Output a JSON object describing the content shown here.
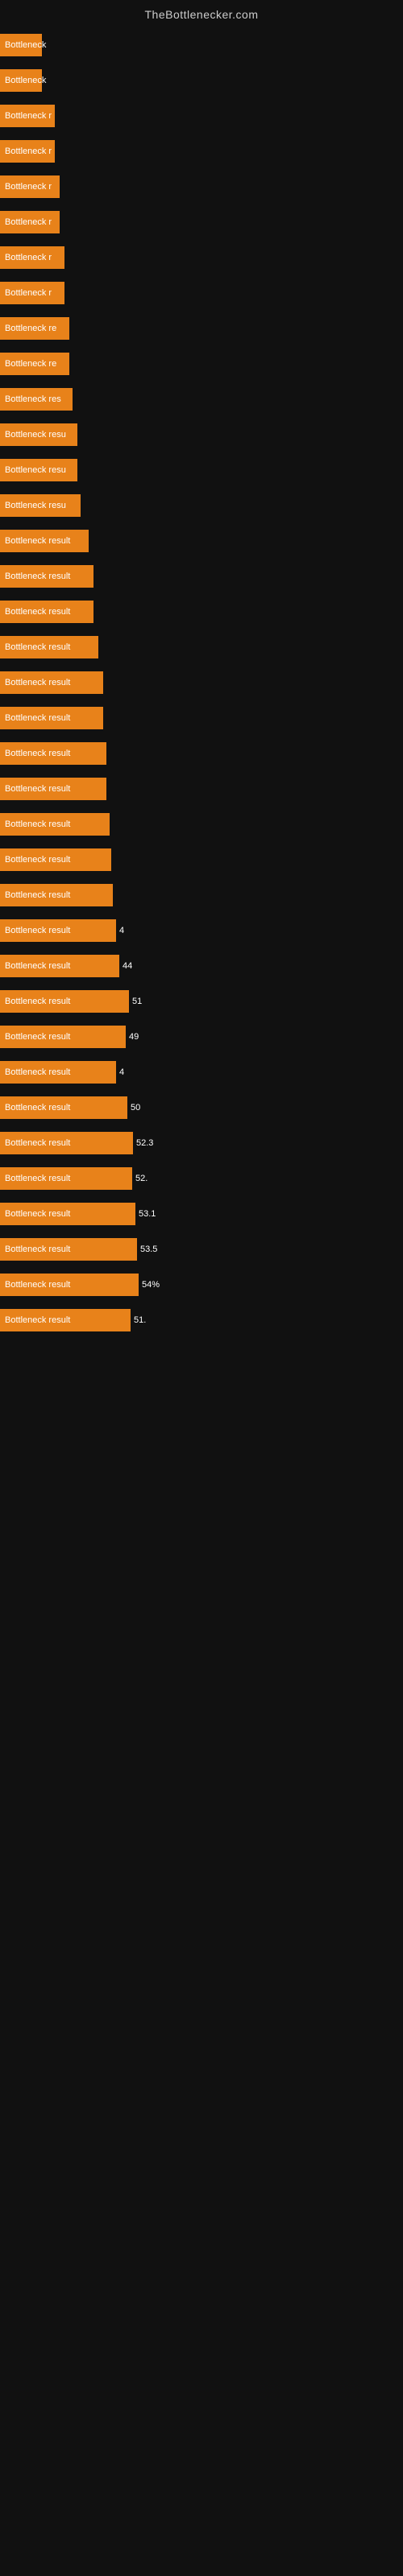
{
  "site_title": "TheBottlenecker.com",
  "bars": [
    {
      "label": "Bottleneck",
      "value": "",
      "width": 52
    },
    {
      "label": "Bottleneck",
      "value": "",
      "width": 52
    },
    {
      "label": "Bottleneck r",
      "value": "",
      "width": 68
    },
    {
      "label": "Bottleneck r",
      "value": "",
      "width": 68
    },
    {
      "label": "Bottleneck r",
      "value": "",
      "width": 74
    },
    {
      "label": "Bottleneck r",
      "value": "",
      "width": 74
    },
    {
      "label": "Bottleneck r",
      "value": "",
      "width": 80
    },
    {
      "label": "Bottleneck r",
      "value": "",
      "width": 80
    },
    {
      "label": "Bottleneck re",
      "value": "",
      "width": 86
    },
    {
      "label": "Bottleneck re",
      "value": "",
      "width": 86
    },
    {
      "label": "Bottleneck res",
      "value": "",
      "width": 90
    },
    {
      "label": "Bottleneck resu",
      "value": "",
      "width": 96
    },
    {
      "label": "Bottleneck resu",
      "value": "",
      "width": 96
    },
    {
      "label": "Bottleneck resu",
      "value": "",
      "width": 100
    },
    {
      "label": "Bottleneck result",
      "value": "",
      "width": 110
    },
    {
      "label": "Bottleneck result",
      "value": "",
      "width": 116
    },
    {
      "label": "Bottleneck result",
      "value": "",
      "width": 116
    },
    {
      "label": "Bottleneck result",
      "value": "",
      "width": 122
    },
    {
      "label": "Bottleneck result",
      "value": "",
      "width": 128
    },
    {
      "label": "Bottleneck result",
      "value": "",
      "width": 128
    },
    {
      "label": "Bottleneck result",
      "value": "",
      "width": 132
    },
    {
      "label": "Bottleneck result",
      "value": "",
      "width": 132
    },
    {
      "label": "Bottleneck result",
      "value": "",
      "width": 136
    },
    {
      "label": "Bottleneck result",
      "value": "",
      "width": 138
    },
    {
      "label": "Bottleneck result",
      "value": "",
      "width": 140
    },
    {
      "label": "Bottleneck result",
      "value": "4",
      "width": 144
    },
    {
      "label": "Bottleneck result",
      "value": "44",
      "width": 148
    },
    {
      "label": "Bottleneck result",
      "value": "51",
      "width": 160
    },
    {
      "label": "Bottleneck result",
      "value": "49",
      "width": 156
    },
    {
      "label": "Bottleneck result",
      "value": "4",
      "width": 144
    },
    {
      "label": "Bottleneck result",
      "value": "50",
      "width": 158
    },
    {
      "label": "Bottleneck result",
      "value": "52.3",
      "width": 165
    },
    {
      "label": "Bottleneck result",
      "value": "52.",
      "width": 164
    },
    {
      "label": "Bottleneck result",
      "value": "53.1",
      "width": 168
    },
    {
      "label": "Bottleneck result",
      "value": "53.5",
      "width": 170
    },
    {
      "label": "Bottleneck result",
      "value": "54%",
      "width": 172
    },
    {
      "label": "Bottleneck result",
      "value": "51.",
      "width": 162
    }
  ]
}
